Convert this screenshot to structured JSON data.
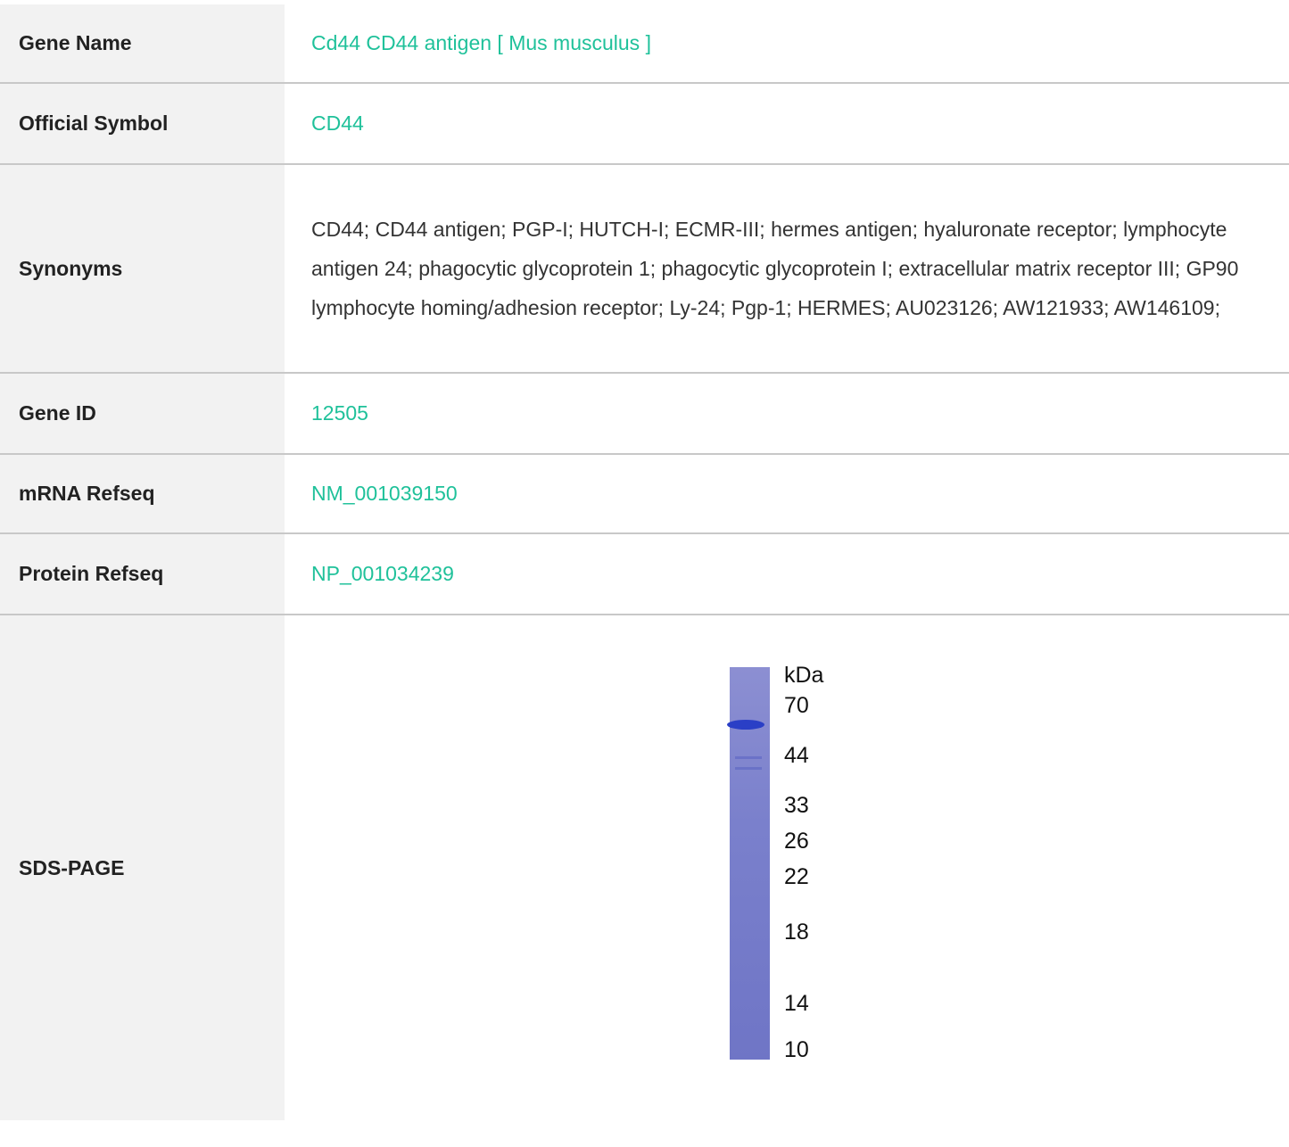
{
  "rows": {
    "gene_name": {
      "label": "Gene Name",
      "value": "Cd44 CD44 antigen [ Mus musculus ]"
    },
    "official_symbol": {
      "label": "Official Symbol",
      "value": "CD44"
    },
    "synonyms": {
      "label": "Synonyms",
      "value": "CD44; CD44 antigen; PGP-I; HUTCH-I; ECMR-III; hermes antigen; hyaluronate receptor; lymphocyte antigen 24; phagocytic glycoprotein 1; phagocytic glycoprotein I; extracellular matrix receptor III; GP90 lymphocyte homing/adhesion receptor; Ly-24; Pgp-1; HERMES; AU023126; AW121933; AW146109;"
    },
    "gene_id": {
      "label": "Gene ID",
      "value": "12505"
    },
    "mrna_refseq": {
      "label": "mRNA Refseq",
      "value": "NM_001039150"
    },
    "protein_refseq": {
      "label": "Protein Refseq",
      "value": "NP_001034239"
    },
    "sds_page": {
      "label": "SDS-PAGE"
    }
  },
  "gel": {
    "unit": "kDa",
    "markers": [
      "70",
      "44",
      "33",
      "26",
      "22",
      "18",
      "14",
      "10"
    ]
  },
  "colors": {
    "link": "#1fc19a",
    "label_bg": "#f2f2f2",
    "divider": "#c8c8c8"
  }
}
